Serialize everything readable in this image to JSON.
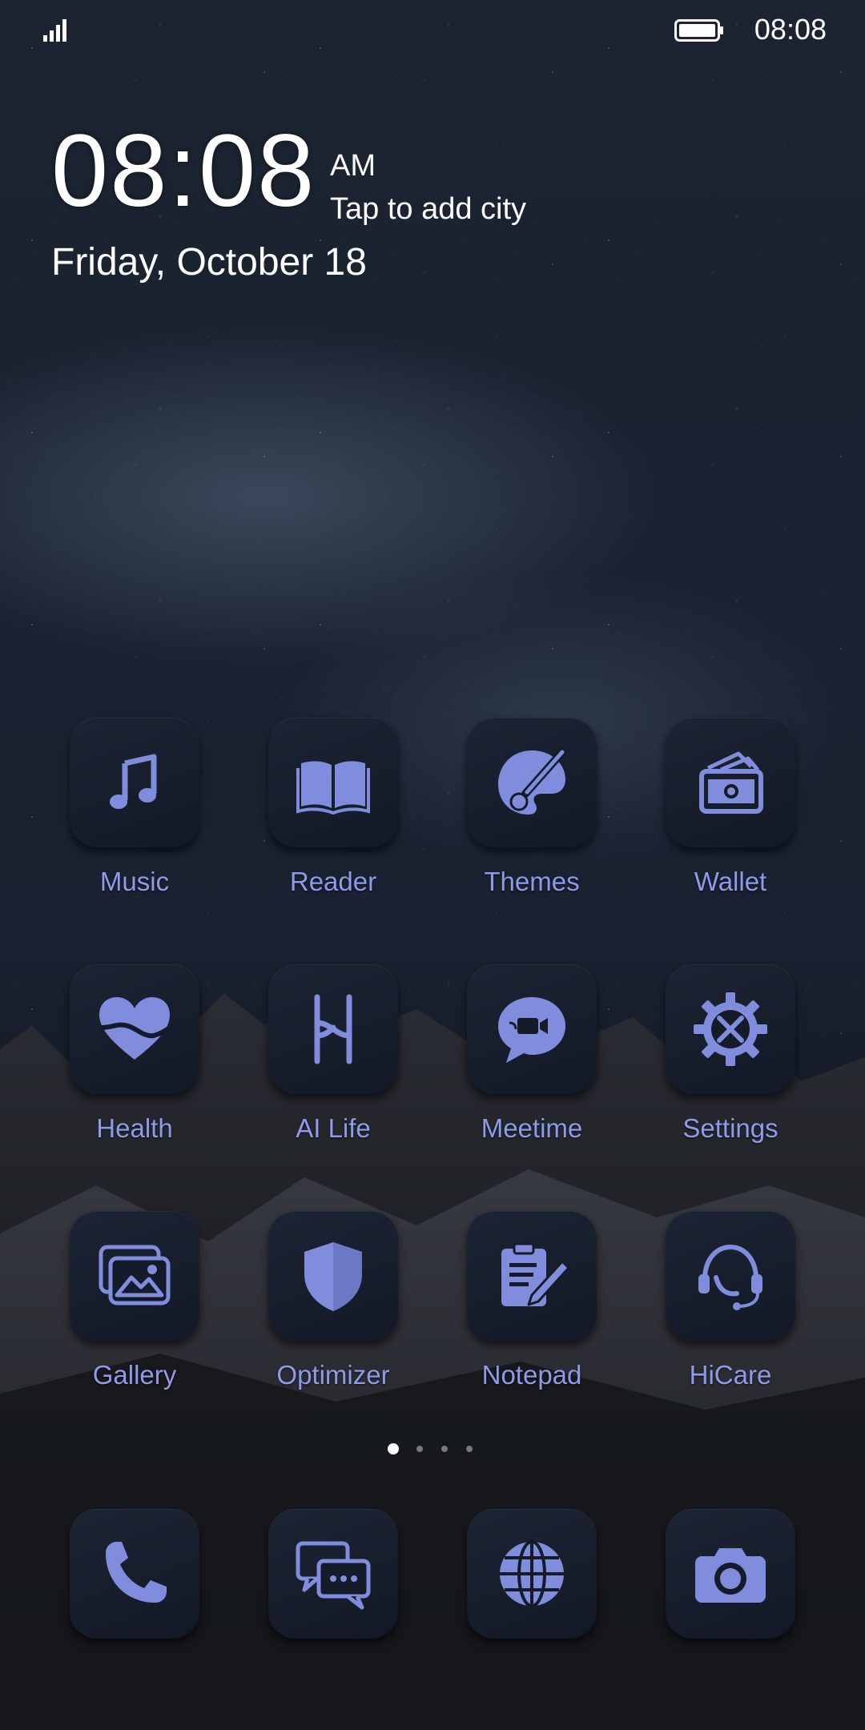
{
  "status_bar": {
    "time": "08:08"
  },
  "clock_widget": {
    "time": "08:08",
    "ampm": "AM",
    "city_prompt": "Tap to add city",
    "date": "Friday, October 18"
  },
  "apps": [
    {
      "label": "Music",
      "icon": "music-note-icon"
    },
    {
      "label": "Reader",
      "icon": "book-icon"
    },
    {
      "label": "Themes",
      "icon": "paintbrush-palette-icon"
    },
    {
      "label": "Wallet",
      "icon": "wallet-icon"
    },
    {
      "label": "Health",
      "icon": "heart-icon"
    },
    {
      "label": "AI Life",
      "icon": "ai-life-icon"
    },
    {
      "label": "Meetime",
      "icon": "video-chat-icon"
    },
    {
      "label": "Settings",
      "icon": "gear-tools-icon"
    },
    {
      "label": "Gallery",
      "icon": "photos-icon"
    },
    {
      "label": "Optimizer",
      "icon": "shield-icon"
    },
    {
      "label": "Notepad",
      "icon": "notepad-pencil-icon"
    },
    {
      "label": "HiCare",
      "icon": "headset-icon"
    }
  ],
  "dock": [
    {
      "icon": "phone-icon"
    },
    {
      "icon": "messages-icon"
    },
    {
      "icon": "globe-icon"
    },
    {
      "icon": "camera-icon"
    }
  ],
  "page_indicator": {
    "pages": 4,
    "current": 1
  },
  "colors": {
    "icon_glyph": "#7f8ddc",
    "label": "#8f9ae8"
  }
}
